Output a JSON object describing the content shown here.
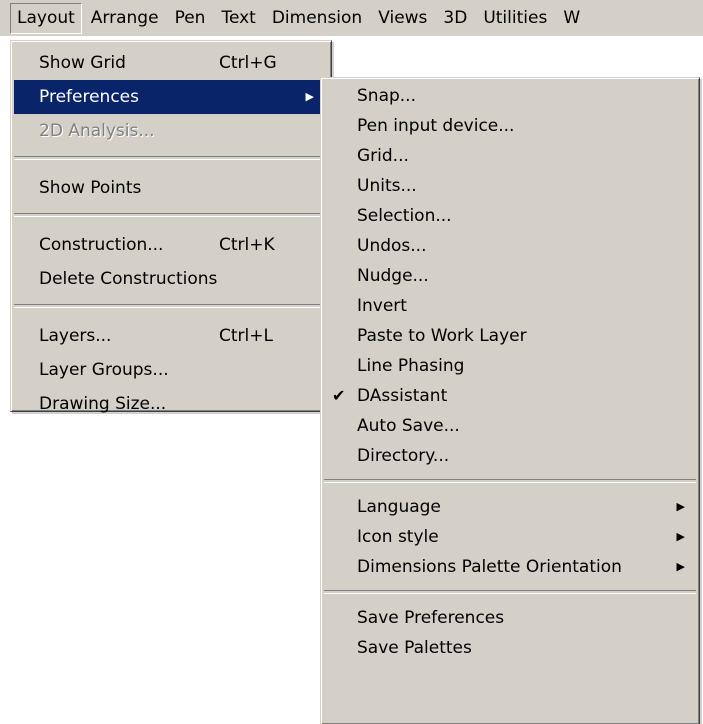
{
  "menubar": {
    "items": [
      "Layout",
      "Arrange",
      "Pen",
      "Text",
      "Dimension",
      "Views",
      "3D",
      "Utilities",
      "W"
    ]
  },
  "layout_menu": {
    "items": [
      {
        "label": "Show Grid",
        "shortcut": "Ctrl+G"
      },
      {
        "label": "Preferences"
      },
      {
        "label": "2D Analysis..."
      },
      {
        "label": "Show Points"
      },
      {
        "label": "Construction...",
        "shortcut": "Ctrl+K"
      },
      {
        "label": "Delete Constructions"
      },
      {
        "label": "Layers...",
        "shortcut": "Ctrl+L"
      },
      {
        "label": "Layer Groups..."
      },
      {
        "label": "Drawing Size..."
      }
    ]
  },
  "preferences_menu": {
    "items": [
      {
        "label": "Snap..."
      },
      {
        "label": "Pen input device..."
      },
      {
        "label": "Grid..."
      },
      {
        "label": "Units..."
      },
      {
        "label": "Selection..."
      },
      {
        "label": "Undos..."
      },
      {
        "label": "Nudge..."
      },
      {
        "label": "Invert"
      },
      {
        "label": "Paste to Work Layer"
      },
      {
        "label": "Line Phasing"
      },
      {
        "label": "DAssistant"
      },
      {
        "label": "Auto Save..."
      },
      {
        "label": "Directory..."
      },
      {
        "label": "Language"
      },
      {
        "label": "Icon style"
      },
      {
        "label": "Dimensions Palette Orientation"
      },
      {
        "label": "Save Preferences"
      },
      {
        "label": "Save Palettes"
      }
    ]
  },
  "colors": {
    "menu_bg": "#d4d0c8",
    "highlight": "#0a246a",
    "disabled": "#808080"
  },
  "icons": {
    "submenu_arrow": "triangle-right-icon",
    "check": "checkmark-icon"
  }
}
